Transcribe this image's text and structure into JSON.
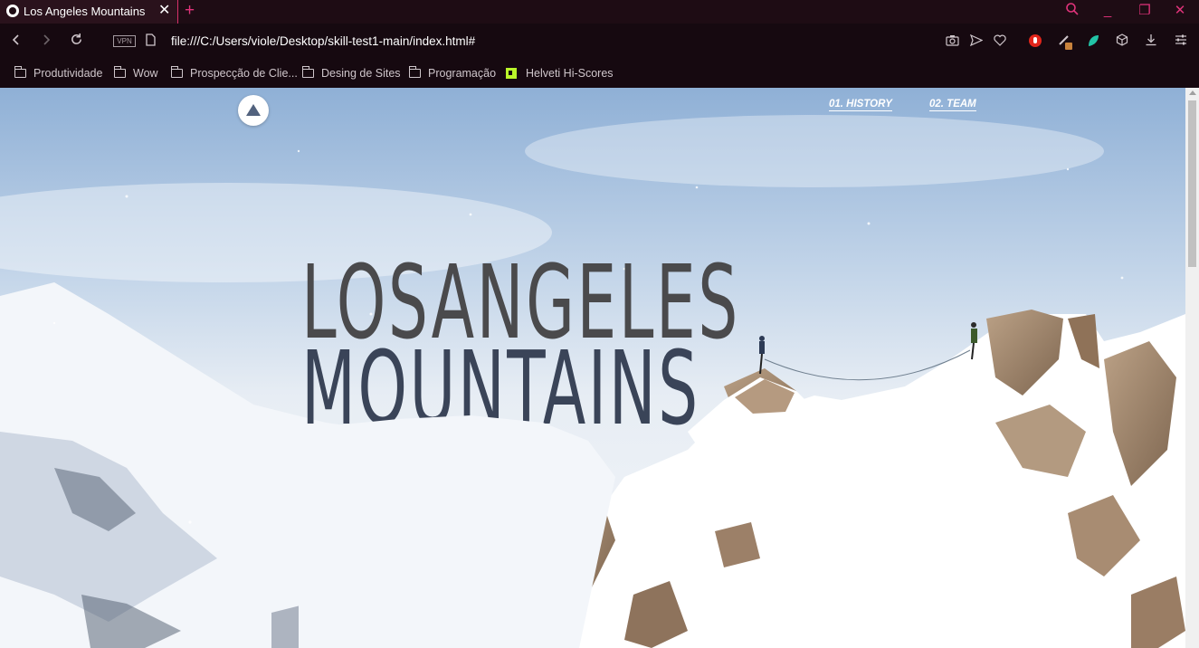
{
  "tab": {
    "title": "Los Angeles Mountains"
  },
  "address": {
    "url": "file:///C:/Users/viole/Desktop/skill-test1-main/index.html#",
    "vpn_label": "VPN"
  },
  "bookmarks": [
    {
      "label": "Produtividade",
      "icon": "folder-icon"
    },
    {
      "label": "Wow",
      "icon": "folder-icon"
    },
    {
      "label": "Prospecção de Clie...",
      "icon": "folder-icon"
    },
    {
      "label": "Desing de Sites",
      "icon": "folder-icon"
    },
    {
      "label": "Programação",
      "icon": "folder-icon"
    },
    {
      "label": "Helveti Hi-Scores",
      "icon": "site-icon"
    }
  ],
  "site": {
    "nav": [
      {
        "label": "01. HISTORY"
      },
      {
        "label": "02. TEAM"
      }
    ],
    "hero": {
      "line1": "LOSANGELES",
      "line2": "MOUNTAINS"
    }
  },
  "colors": {
    "accent": "#e0337a",
    "chrome": "#160910",
    "hero_top": "#4a4a4c",
    "hero_bottom": "#3a4458"
  }
}
